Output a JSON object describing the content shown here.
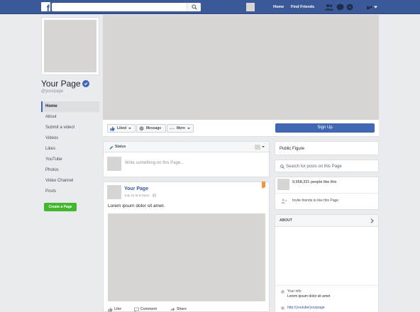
{
  "colors": {
    "brand": "#3b5998",
    "button_blue": "#4267b2",
    "create_green": "#42b72a",
    "placeholder_gray": "#d8d5d5",
    "pin_orange": "#f7923b"
  },
  "topbar": {
    "logo_letter": "f",
    "search_icon": "magnifier-icon",
    "nav": {
      "home": "Home",
      "find_friends": "Find Friends"
    },
    "icons": [
      "friends-icon",
      "messages-icon",
      "notifications-icon",
      "help-icon",
      "account-caret-icon"
    ]
  },
  "profile": {
    "name": "Your Page",
    "handle": "@yourpage",
    "verified_icon": "verified-check-icon"
  },
  "sidebar": {
    "items": [
      {
        "label": "Home",
        "active": true
      },
      {
        "label": "About"
      },
      {
        "label": "Submit a video!"
      },
      {
        "label": "Videos"
      },
      {
        "label": "Likes"
      },
      {
        "label": "YouTube"
      },
      {
        "label": "Photos"
      },
      {
        "label": "Video Channel"
      },
      {
        "label": "Posts"
      }
    ],
    "create_page": "Create a Page"
  },
  "actions": {
    "liked": "Liked",
    "message": "Message",
    "more": "More",
    "signup": "Sign Up"
  },
  "composer": {
    "tab": "Status",
    "placeholder": "Write something on this Page..."
  },
  "post": {
    "author": "Your Page",
    "time": "July 22 at 6:31pm · ",
    "text": "Lorem ipsum dolor sit amet.",
    "actions": {
      "like": "Like",
      "comment": "Comment",
      "share": "Share"
    }
  },
  "right": {
    "category": "Public Figure",
    "search_placeholder": "Search for posts on this Page",
    "likes_count": "9,658,321 people like this",
    "invite": "Invite friends to like this Page",
    "about_title": "ABOUT",
    "info_label": "Your info",
    "info_value": "Lorem ipsum dolor sit amet",
    "link": "http://youtube/yourpage"
  }
}
